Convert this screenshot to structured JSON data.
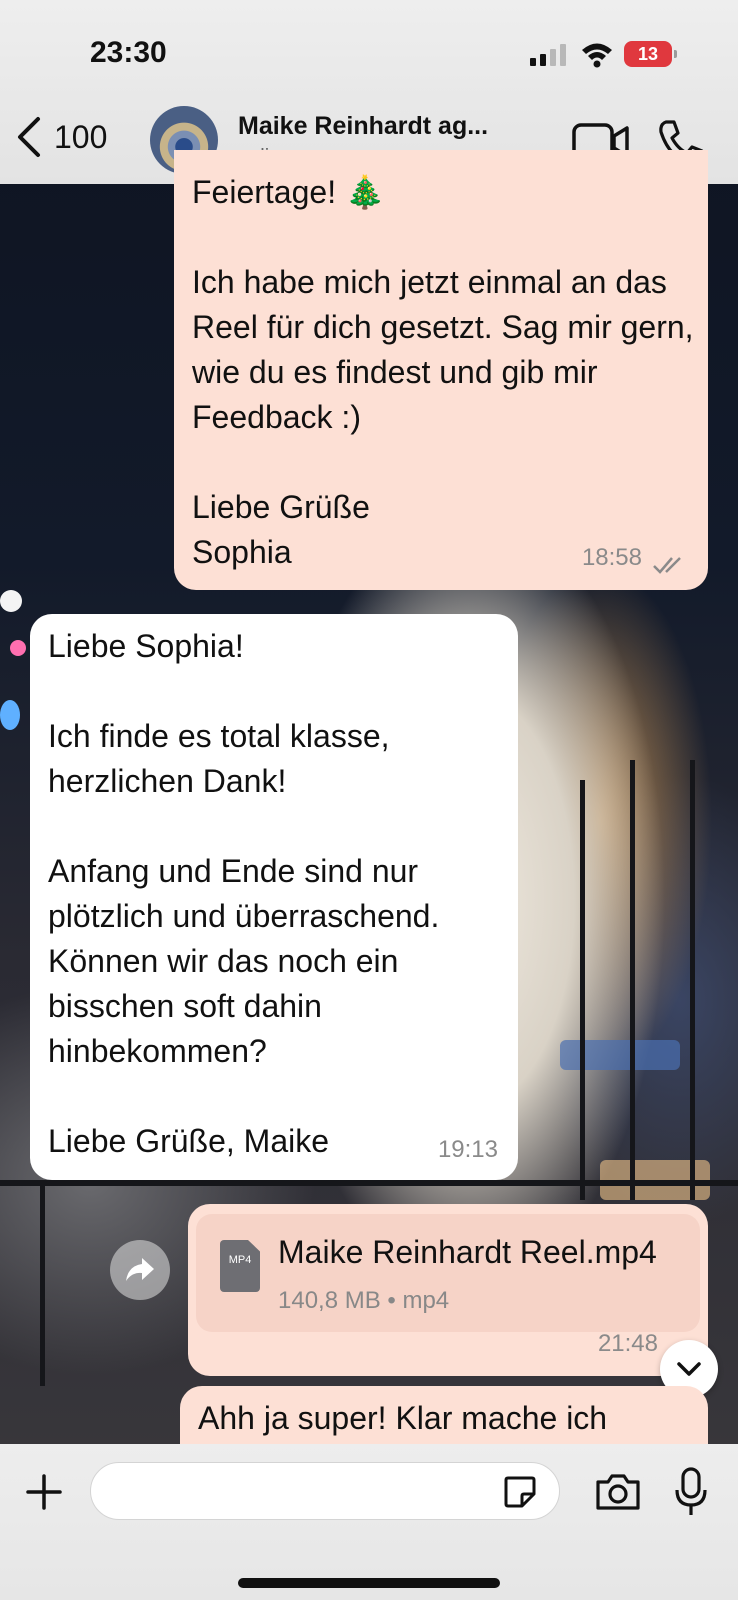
{
  "status_bar": {
    "time": "23:30",
    "battery_level": "13",
    "battery_color": "#e0383e",
    "icons": [
      "signal-icon",
      "wifi-icon",
      "battery-icon"
    ]
  },
  "header": {
    "back_count": "100",
    "contact_name": "Maike Reinhardt ag...",
    "contact_status": "online",
    "icons": [
      "chevron-left-icon",
      "video-call-icon",
      "phone-icon"
    ]
  },
  "messages": [
    {
      "direction": "outgoing",
      "text": "Feiertage! 🎄\n\nIch habe mich jetzt einmal an das Reel für dich gesetzt. Sag mir gern, wie du es findest und gib mir Feedback :)\n\nLiebe Grüße\nSophia",
      "time": "18:58",
      "status": "read-double-check"
    },
    {
      "direction": "incoming",
      "text": "Liebe Sophia!\n\nIch finde es total klasse, herzlichen Dank!\n\nAnfang und Ende sind nur plötzlich und überraschend. Können wir das noch ein bisschen soft dahin hinbekommen?\n\nLiebe Grüße, Maike",
      "time": "19:13"
    },
    {
      "direction": "outgoing",
      "type": "file",
      "file_name": "Maike Reinhardt Reel.mp4",
      "file_meta": "140,8 MB • mp4",
      "file_badge": "MP4",
      "time": "21:48"
    },
    {
      "direction": "outgoing",
      "text": "Ahh ja super! Klar mache ich"
    }
  ],
  "input_bar": {
    "placeholder": "",
    "icons": [
      "plus-icon",
      "sticker-icon",
      "camera-icon",
      "microphone-icon"
    ]
  },
  "colors": {
    "outgoing_bubble": "#fde0d5",
    "incoming_bubble": "#ffffff",
    "header_bg": "#e8e8e8"
  }
}
